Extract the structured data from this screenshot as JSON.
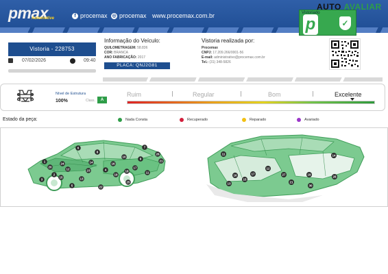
{
  "header": {
    "brand": "pmax",
    "brand_sub": "Automotive",
    "facebook_handle": "procemax",
    "instagram_handle": "procemax",
    "website": "www.procemax.com.br",
    "partner_brand_a": "AUTO",
    "partner_brand_b": "AVALIAR",
    "seal_label": "Vistoriado",
    "seal_letter": "p",
    "seal_check": "✓"
  },
  "vistoria": {
    "label": "Vistoria - 228753",
    "date": "07/02/2026",
    "time": "09:40"
  },
  "vehicle": {
    "title": "Informação do Veículo:",
    "mileage_label": "QUILOMETRAGEM:",
    "mileage": "58.836",
    "color_label": "COR:",
    "color": "BRANCA",
    "year_label": "ANO FABRICAÇÃO:",
    "year": "2017",
    "plate_label": "PLACA: QNJ2G81"
  },
  "inspector": {
    "title": "Vistoria realizada por:",
    "company": "Procemax",
    "cnpj_label": "CNPJ:",
    "cnpj": "17.209.266/0001-56",
    "email_label": "E-mail:",
    "email": "administrativo@procemax.com.br",
    "phone_label": "Tel.:",
    "phone": "(31) 348-5826"
  },
  "structure": {
    "label": "Nível de Estrutura",
    "value": "100%",
    "class_label": "Class.",
    "grade": "A",
    "scale": [
      "Ruim",
      "Regular",
      "Bom",
      "Excelente"
    ],
    "level": 0.9
  },
  "legend": {
    "title": "Estado da peça:",
    "items": [
      {
        "label": "Nada Consta",
        "color": "#2e9d48"
      },
      {
        "label": "Recuperado",
        "color": "#d21f3c"
      },
      {
        "label": "Reparado",
        "color": "#f2c014"
      },
      {
        "label": "Avariado",
        "color": "#9b36c9"
      }
    ]
  },
  "colors": {
    "header_blue": "#1f4d93",
    "body_green": "#5fbf7a",
    "accent_green": "#2e9d48"
  },
  "car_left_badges": [
    "1",
    "2",
    "3",
    "4",
    "5",
    "6",
    "7",
    "8",
    "9",
    "10",
    "11",
    "12",
    "13",
    "14",
    "15",
    "16",
    "17",
    "18",
    "19",
    "20",
    "21",
    "22",
    "23",
    "24",
    "25",
    "26"
  ],
  "car_right_badges": [
    "11",
    "12",
    "13",
    "14",
    "15",
    "16",
    "17",
    "19",
    "21",
    "27",
    "28",
    "30"
  ]
}
